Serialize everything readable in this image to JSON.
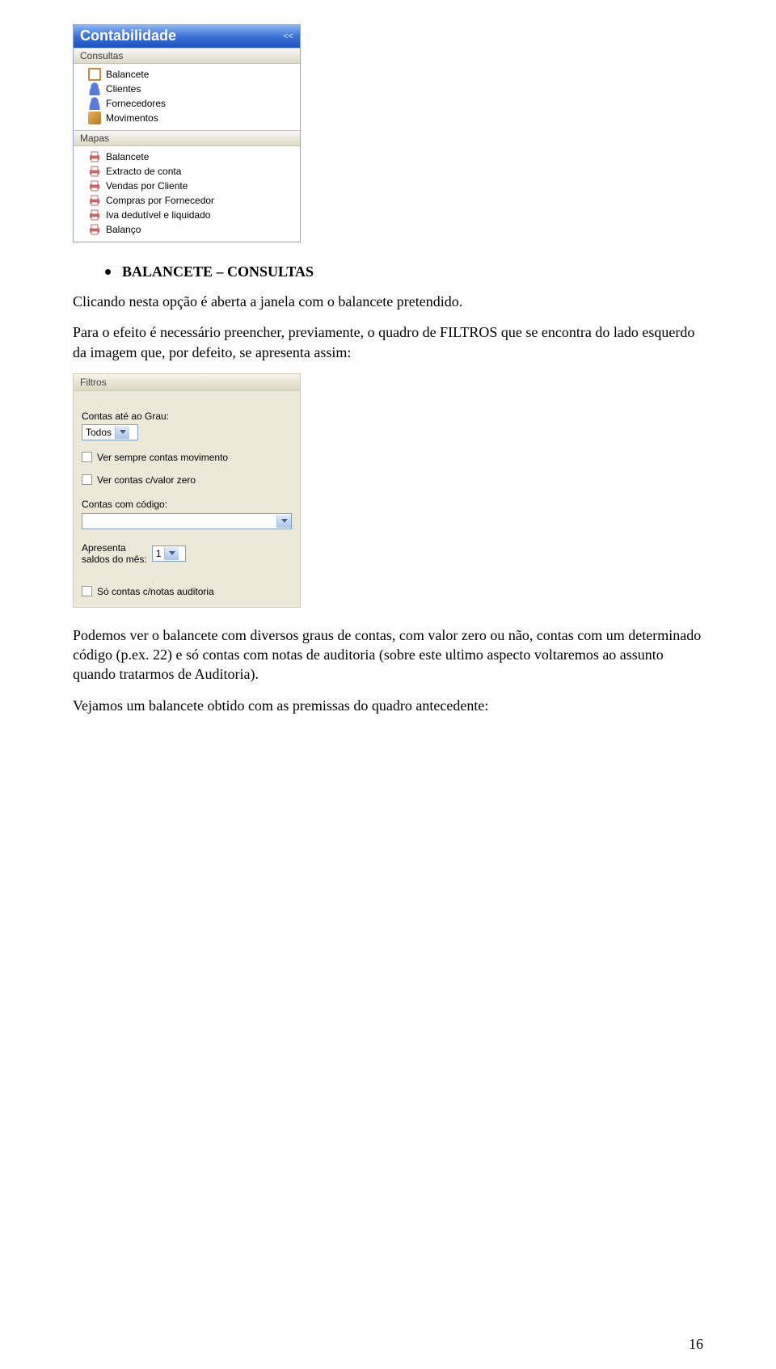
{
  "sidebar": {
    "title": "Contabilidade",
    "collapse_symbol": "<<",
    "sections": [
      {
        "label": "Consultas",
        "items": [
          {
            "label": "Balancete",
            "icon": "doc"
          },
          {
            "label": "Clientes",
            "icon": "person"
          },
          {
            "label": "Fornecedores",
            "icon": "person"
          },
          {
            "label": "Movimentos",
            "icon": "box"
          }
        ]
      },
      {
        "label": "Mapas",
        "items": [
          {
            "label": "Balancete",
            "icon": "print"
          },
          {
            "label": "Extracto de conta",
            "icon": "print"
          },
          {
            "label": "Vendas por Cliente",
            "icon": "print"
          },
          {
            "label": "Compras por Fornecedor",
            "icon": "print"
          },
          {
            "label": "Iva dedutível e liquidado",
            "icon": "print"
          },
          {
            "label": "Balanço",
            "icon": "print"
          }
        ]
      }
    ]
  },
  "bullet_heading": "BALANCETE – CONSULTAS",
  "paragraphs": {
    "p1": "Clicando nesta opção é aberta a janela com o balancete pretendido.",
    "p2": "Para o efeito é necessário preencher, previamente, o quadro de FILTROS que se encontra do lado esquerdo da imagem que, por defeito, se apresenta assim:",
    "p3": "Podemos ver o balancete com diversos graus de contas, com valor zero ou não, contas com um determinado código (p.ex. 22) e só contas com notas de auditoria (sobre este ultimo aspecto voltaremos ao assunto quando tratarmos de Auditoria).",
    "p4": "Vejamos um balancete obtido com as premissas do quadro antecedente:"
  },
  "filters": {
    "title": "Filtros",
    "grau_label": "Contas até ao Grau:",
    "grau_value": "Todos",
    "cb_movimento": "Ver sempre contas movimento",
    "cb_valor_zero": "Ver contas c/valor zero",
    "codigo_label": "Contas com código:",
    "codigo_value": "",
    "saldos_label_a": "Apresenta",
    "saldos_label_b": "saldos do mês:",
    "saldos_value": "1",
    "cb_auditoria": "Só contas c/notas auditoria"
  },
  "page_number": "16"
}
